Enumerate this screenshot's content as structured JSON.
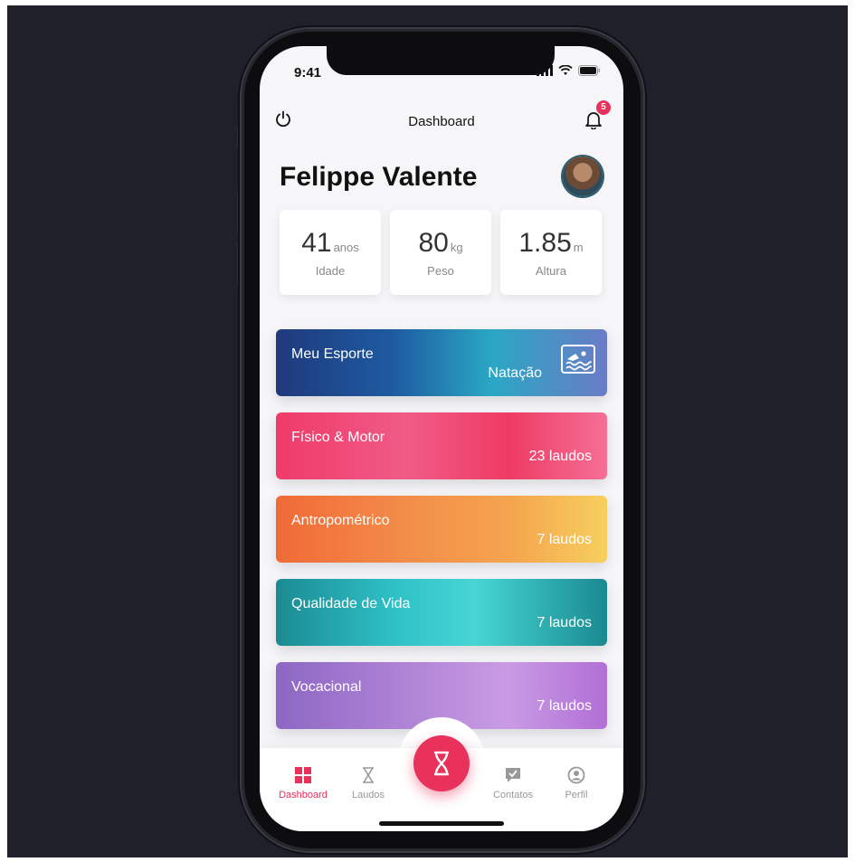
{
  "status_bar": {
    "time": "9:41"
  },
  "header": {
    "title": "Dashboard",
    "notification_count": "5"
  },
  "profile": {
    "name": "Felippe Valente"
  },
  "stats": [
    {
      "value": "41",
      "unit": "anos",
      "label": "Idade"
    },
    {
      "value": "80",
      "unit": "kg",
      "label": "Peso"
    },
    {
      "value": "1.85",
      "unit": "m",
      "label": "Altura"
    }
  ],
  "cards": [
    {
      "title": "Meu Esporte",
      "value": "Natação",
      "icon": "swimming-icon"
    },
    {
      "title": "Físico & Motor",
      "count": "23",
      "unit": "laudos"
    },
    {
      "title": "Antropométrico",
      "count": "7",
      "unit": "laudos"
    },
    {
      "title": "Qualidade de Vida",
      "count": "7",
      "unit": "laudos"
    },
    {
      "title": "Vocacional",
      "count": "7",
      "unit": "laudos"
    }
  ],
  "tabbar": {
    "items": [
      {
        "label": "Dashboard",
        "icon": "grid-icon",
        "active": true
      },
      {
        "label": "Laudos",
        "icon": "hourglass-icon",
        "active": false
      },
      {
        "label": "Contatos",
        "icon": "chat-check-icon",
        "active": false
      },
      {
        "label": "Perfil",
        "icon": "person-icon",
        "active": false
      }
    ],
    "center_icon": "dna-icon"
  },
  "colors": {
    "accent": "#e8315b",
    "background": "#1f2029"
  }
}
